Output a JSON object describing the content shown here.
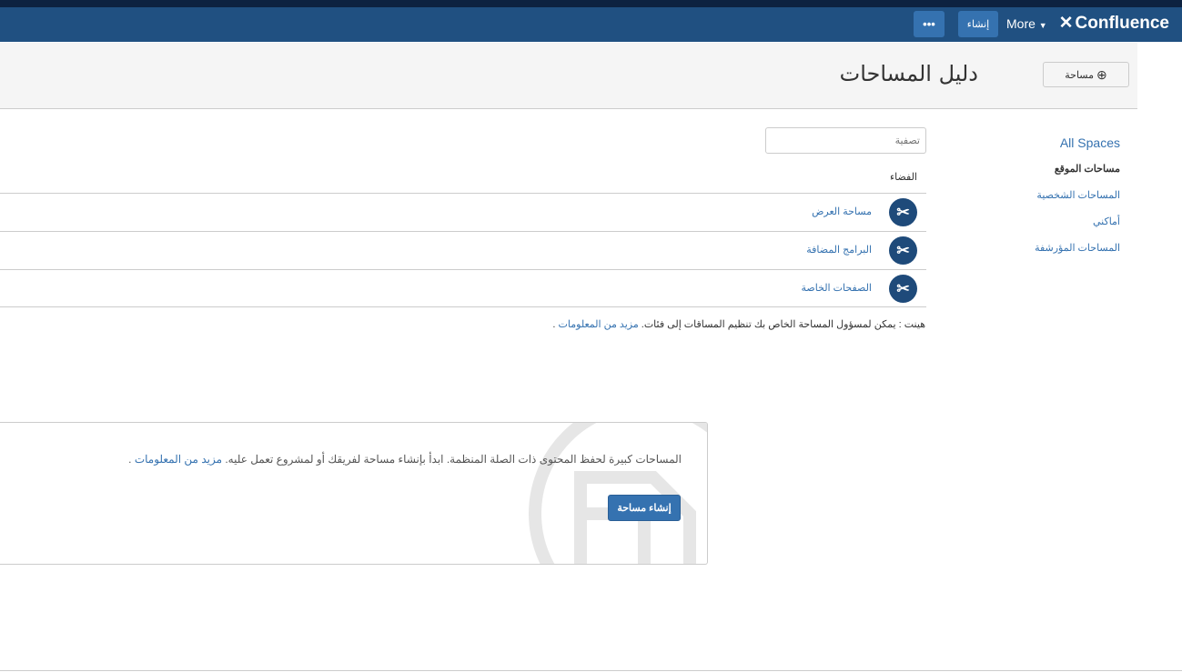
{
  "header": {
    "logo": "Confluence",
    "more_label": "More",
    "create_label": "إنشاء",
    "dots_label": "•••"
  },
  "page": {
    "title": "دليل المساحات",
    "space_button": "مساحة"
  },
  "sidebar": {
    "items": [
      {
        "label": "All Spaces"
      },
      {
        "label": "مساحات الموقع"
      },
      {
        "label": "المساحات الشخصية"
      },
      {
        "label": "أماكني"
      },
      {
        "label": "المساحات المؤرشفة"
      }
    ]
  },
  "filter": {
    "placeholder": "تصفية"
  },
  "table": {
    "column": "الفضاء",
    "rows": [
      {
        "name": "مساحة العرض"
      },
      {
        "name": "البرامج المضافة"
      },
      {
        "name": "الصفحات الخاصة"
      }
    ]
  },
  "tip": {
    "text": "هينت : يمكن لمسؤول المساحة الخاص بك تنظيم المساقات إلى فئات. ",
    "link": "مزيد من المعلومات",
    "end": " ."
  },
  "card": {
    "text": "المساحات كبيرة لحفظ المحتوى ذات الصلة المنظمة. ابدأ بإنشاء مساحة لفريقك أو لمشروع تعمل عليه. ",
    "link": "مزيد من المعلومات",
    "end": " .",
    "button": "إنشاء مساحة"
  }
}
